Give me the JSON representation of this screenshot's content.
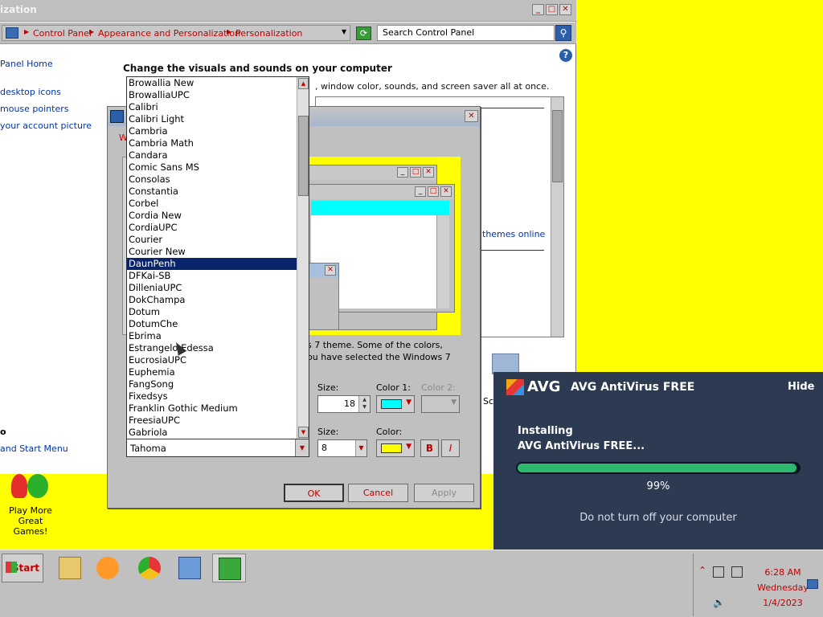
{
  "control_panel": {
    "title": "ization",
    "breadcrumbs": [
      "Control Panel",
      "Appearance and Personalization",
      "Personalization"
    ],
    "search_placeholder": "Search Control Panel",
    "sidebar_links": [
      "Panel Home",
      "desktop icons",
      "mouse pointers",
      "your account picture",
      "o",
      "and Start Menu"
    ],
    "heading": "Change the visuals and sounds on your computer",
    "description": ", window color, sounds, and screen saver all at once.",
    "themes_online": "themes online",
    "side_text_s": "Sc"
  },
  "dialog": {
    "tab_hint": "W",
    "theme_text_1": "s 7 theme.  Some of the colors,",
    "theme_text_2": "ou have selected the Windows 7",
    "size_label": "Size:",
    "size_value": "18",
    "color1_label": "Color 1:",
    "color2_label": "Color 2:",
    "font_size_label": "Size:",
    "font_size_value": "8",
    "font_color_label": "Color:",
    "bold_label": "B",
    "italic_label": "I",
    "ok_label": "OK",
    "cancel_label": "Cancel",
    "apply_label": "Apply",
    "color1_hex": "#00ffff",
    "font_color_hex": "#ffff00"
  },
  "font_dropdown": {
    "items": [
      "Browallia New",
      "BrowalliaUPC",
      "Calibri",
      "Calibri Light",
      "Cambria",
      "Cambria Math",
      "Candara",
      "Comic Sans MS",
      "Consolas",
      "Constantia",
      "Corbel",
      "Cordia New",
      "CordiaUPC",
      "Courier",
      "Courier New",
      "DaunPenh",
      "DFKai-SB",
      "DilleniaUPC",
      "DokChampa",
      "Dotum",
      "DotumChe",
      "Ebrima",
      "Estrangelo Edessa",
      "EucrosiaUPC",
      "Euphemia",
      "FangSong",
      "Fixedsys",
      "Franklin Gothic Medium",
      "FreesiaUPC",
      "Gabriola"
    ],
    "highlighted": "DaunPenh",
    "selected_value": "Tahoma"
  },
  "desktop": {
    "icon_label": "Play More Great Games!"
  },
  "avg": {
    "logo": "AVG",
    "title": "AVG AntiVirus FREE",
    "hide_label": "Hide",
    "installing": "Installing",
    "product": "AVG AntiVirus FREE...",
    "progress": 0.99,
    "percent_text": "99%",
    "warning": "Do not turn off your computer"
  },
  "taskbar": {
    "start_label": "Start",
    "apps": [
      "file-explorer",
      "media-player",
      "chrome",
      "control-panel",
      "personalization"
    ],
    "clock_time": "6:28 AM",
    "clock_day": "Wednesday",
    "clock_date": "1/4/2023"
  },
  "colors": {
    "desktop": "#ffff00",
    "accent_red": "#c00000",
    "avg_bg": "#2c3b52",
    "avg_progress": "#2eb86e",
    "selection": "#0a246a"
  }
}
